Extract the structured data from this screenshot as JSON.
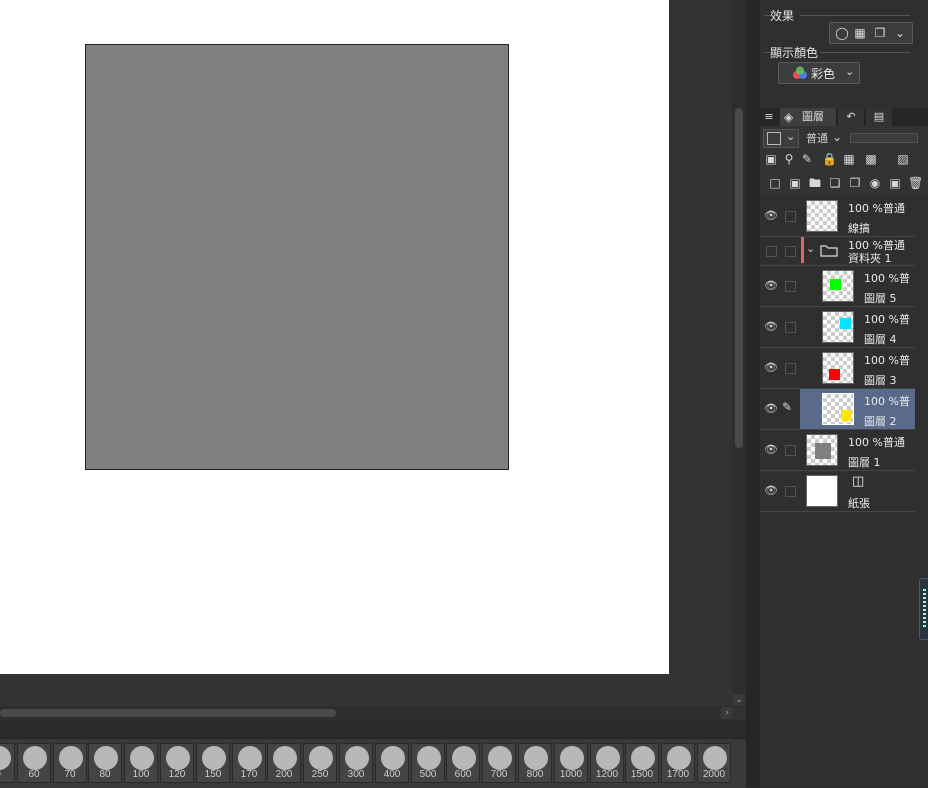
{
  "canvas": {
    "paper_color": "#ffffff",
    "shape_color": "#808080"
  },
  "size_bar": {
    "sizes": [
      "0",
      "60",
      "70",
      "80",
      "100",
      "120",
      "150",
      "170",
      "200",
      "250",
      "300",
      "400",
      "500",
      "600",
      "700",
      "800",
      "1000",
      "1200",
      "1500",
      "1700",
      "2000"
    ]
  },
  "properties": {
    "effect_title": "效果",
    "display_color_title": "顯示顏色",
    "display_color_value": "彩色"
  },
  "layer_panel": {
    "tab_layer_label": "圖層",
    "blend_mode": "普通",
    "layers": [
      {
        "line1": "100 %普通",
        "line2": "線搞",
        "type": "raster"
      },
      {
        "line1": "100 %普通",
        "line2": "資料夾 1",
        "type": "folder"
      },
      {
        "line1": "100 %普",
        "line2": "圖層 5",
        "type": "raster",
        "mark_color": "#00ff00"
      },
      {
        "line1": "100 %普",
        "line2": "圖層 4",
        "type": "raster",
        "mark_color": "#00e5ff"
      },
      {
        "line1": "100 %普",
        "line2": "圖層 3",
        "type": "raster",
        "mark_color": "#ff0000"
      },
      {
        "line1": "100 %普",
        "line2": "圖層 2",
        "type": "raster",
        "mark_color": "#ffe600",
        "selected": true
      },
      {
        "line1": "100 %普通",
        "line2": "圖層 1",
        "type": "raster",
        "mark_color": "#808080"
      },
      {
        "line1": "",
        "line2": "紙張",
        "type": "paper"
      }
    ]
  }
}
